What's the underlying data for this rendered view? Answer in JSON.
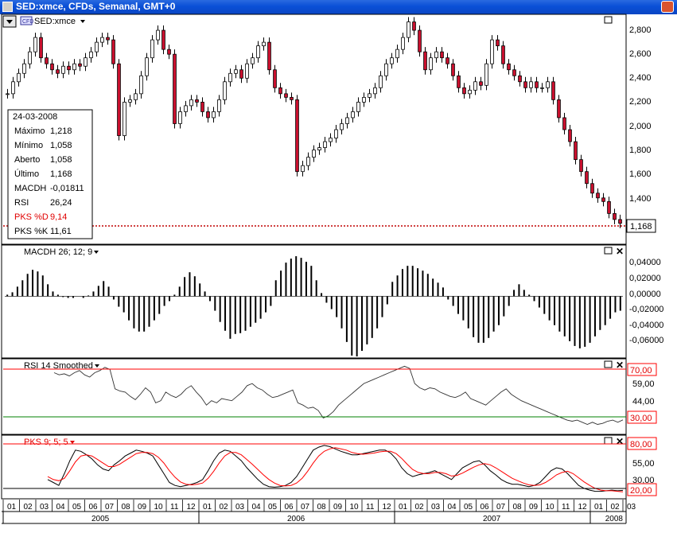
{
  "window": {
    "title": "SED:xmce, CFDs, Semanal, GMT+0"
  },
  "symbol_label": "SED:xmce",
  "price_panel": {
    "y_ticks": [
      "2,800",
      "2,600",
      "2,400",
      "2,200",
      "2,000",
      "1,800",
      "1,600",
      "1,400"
    ],
    "last_price_label": "1,168"
  },
  "info_box": {
    "date": "24-03-2008",
    "rows": [
      {
        "label": "Máximo",
        "value": "1,218"
      },
      {
        "label": "Mínimo",
        "value": "1,058"
      },
      {
        "label": "Aberto",
        "value": "1,058"
      },
      {
        "label": "Último",
        "value": "1,168"
      },
      {
        "label": "MACDH",
        "value": "-0,01811"
      },
      {
        "label": "RSI",
        "value": "26,24"
      },
      {
        "label": "PKS %D",
        "value": "9,14"
      },
      {
        "label": "PKS %K",
        "value": "11,61"
      }
    ]
  },
  "macd_panel": {
    "title": "MACDH 26; 12; 9",
    "y_ticks": [
      "0,04000",
      "0,02000",
      "0,00000",
      "-0,02000",
      "-0,04000",
      "-0,06000"
    ]
  },
  "rsi_panel": {
    "title": "RSI 14 Smoothed",
    "y_ticks": [
      "59,00",
      "44,00"
    ],
    "levels": [
      "70,00",
      "30,00"
    ]
  },
  "pks_panel": {
    "title": "PKS 9; 5; 5",
    "y_ticks": [
      "55,00",
      "30,00"
    ],
    "levels": [
      "80,00",
      "20,00"
    ]
  },
  "x_axis": {
    "months": [
      "01",
      "02",
      "03",
      "04",
      "05",
      "06",
      "07",
      "08",
      "09",
      "10",
      "11",
      "12",
      "01",
      "02",
      "03",
      "04",
      "05",
      "06",
      "07",
      "08",
      "09",
      "10",
      "11",
      "12",
      "01",
      "02",
      "03",
      "04",
      "05",
      "06",
      "07",
      "08",
      "09",
      "10",
      "11",
      "12",
      "01",
      "02",
      "03"
    ],
    "years": [
      "2005",
      "2006",
      "2007",
      "2008"
    ]
  },
  "colors": {
    "up_candle": "#ffffff",
    "down_candle": "#c8102e",
    "pks_d": "#ff0000",
    "pks_k": "#000000",
    "level_red": "#ff0000",
    "level_green": "#008000",
    "last_price_line": "#c00000"
  },
  "chart_data": [
    {
      "type": "candlestick",
      "title": "SED:xmce, CFDs, Semanal, GMT+0",
      "x_unit": "week",
      "ylim": [
        1.0,
        2.9
      ],
      "series": [
        {
          "values": [
            2.25,
            2.35,
            2.42,
            2.5,
            2.6,
            2.72,
            2.55,
            2.5,
            2.45,
            2.42,
            2.48,
            2.45,
            2.5,
            2.48,
            2.55,
            2.6,
            2.68,
            2.72,
            2.7,
            2.5,
            1.9,
            2.18,
            2.2,
            2.25,
            2.4,
            2.55,
            2.7,
            2.78,
            2.62,
            2.58,
            2.0,
            2.1,
            2.15,
            2.2,
            2.18,
            2.1,
            2.05,
            2.1,
            2.2,
            2.35,
            2.42,
            2.45,
            2.38,
            2.5,
            2.55,
            2.65,
            2.68,
            2.45,
            2.3,
            2.25,
            2.22,
            2.2,
            1.6,
            1.65,
            1.72,
            1.78,
            1.8,
            1.85,
            1.88,
            1.95,
            2.0,
            2.05,
            2.1,
            2.18,
            2.22,
            2.25,
            2.3,
            2.4,
            2.5,
            2.55,
            2.62,
            2.72,
            2.85,
            2.78,
            2.6,
            2.45,
            2.55,
            2.6,
            2.55,
            2.5,
            2.4,
            2.3,
            2.25,
            2.28,
            2.35,
            2.32,
            2.5,
            2.7,
            2.65,
            2.5,
            2.45,
            2.4,
            2.35,
            2.3,
            2.35,
            2.3,
            2.3,
            2.35,
            2.2,
            2.05,
            1.95,
            1.85,
            1.7,
            1.6,
            1.5,
            1.42,
            1.38,
            1.35,
            1.25,
            1.2,
            1.168
          ]
        }
      ]
    },
    {
      "type": "bar",
      "title": "MACDH 26; 12; 9",
      "ylim": [
        -0.075,
        0.06
      ],
      "series": [
        {
          "values": [
            0.002,
            0.005,
            0.012,
            0.02,
            0.028,
            0.033,
            0.031,
            0.026,
            0.015,
            0.006,
            0.002,
            -0.001,
            -0.002,
            -0.002,
            0.0,
            -0.002,
            0.001,
            0.006,
            0.013,
            0.019,
            0.012,
            -0.004,
            -0.013,
            -0.02,
            -0.03,
            -0.04,
            -0.044,
            -0.044,
            -0.038,
            -0.03,
            -0.022,
            -0.012,
            -0.006,
            0.002,
            0.012,
            0.024,
            0.03,
            0.025,
            0.016,
            0.006,
            -0.006,
            -0.018,
            -0.032,
            -0.043,
            -0.053,
            -0.047,
            -0.046,
            -0.043,
            -0.038,
            -0.033,
            -0.028,
            -0.02,
            -0.012,
            0.02,
            0.032,
            0.042,
            0.047,
            0.05,
            0.048,
            0.043,
            0.038,
            0.02,
            0.004,
            -0.008,
            -0.016,
            -0.026,
            -0.04,
            -0.057,
            -0.074,
            -0.075,
            -0.068,
            -0.06,
            -0.052,
            -0.04,
            -0.026,
            -0.01,
            0.018,
            0.026,
            0.034,
            0.038,
            0.038,
            0.035,
            0.032,
            0.028,
            0.022,
            0.017,
            0.011,
            -0.004,
            -0.012,
            -0.022,
            -0.03,
            -0.04,
            -0.051,
            -0.058,
            -0.058,
            -0.052,
            -0.044,
            -0.036,
            -0.025,
            -0.012,
            0.008,
            0.015,
            0.008,
            0.002,
            -0.006,
            -0.014,
            -0.022,
            -0.03,
            -0.036,
            -0.044,
            -0.05,
            -0.056,
            -0.062,
            -0.065,
            -0.063,
            -0.058,
            -0.05,
            -0.042,
            -0.036,
            -0.028,
            -0.02,
            -0.018
          ]
        }
      ]
    },
    {
      "type": "line",
      "title": "RSI 14 Smoothed",
      "ylim": [
        15,
        80
      ],
      "series": [
        {
          "values": [
            70,
            68,
            69,
            67,
            70,
            72,
            68,
            66,
            70,
            72,
            75,
            73,
            55,
            53,
            52,
            48,
            45,
            50,
            56,
            52,
            42,
            44,
            52,
            49,
            47,
            50,
            55,
            58,
            52,
            47,
            40,
            44,
            42,
            46,
            45,
            44,
            48,
            52,
            58,
            60,
            56,
            54,
            50,
            47,
            48,
            50,
            52,
            54,
            42,
            40,
            37,
            38,
            35,
            28,
            30,
            34,
            40,
            44,
            48,
            52,
            56,
            60,
            62,
            64,
            66,
            68,
            70,
            72,
            74,
            76,
            74,
            60,
            56,
            54,
            56,
            55,
            52,
            50,
            48,
            47,
            49,
            52,
            46,
            44,
            42,
            40,
            44,
            48,
            52,
            55,
            50,
            47,
            44,
            42,
            40,
            38,
            36,
            34,
            32,
            30,
            28,
            26,
            25,
            26,
            24,
            22,
            24,
            22,
            23,
            25,
            26,
            24,
            26.24
          ]
        }
      ]
    },
    {
      "type": "line",
      "title": "PKS 9; 5; 5",
      "ylim": [
        0,
        100
      ],
      "series": [
        {
          "name": "PKS %K",
          "values": [
            30,
            25,
            20,
            40,
            62,
            80,
            78,
            72,
            65,
            55,
            48,
            45,
            55,
            62,
            70,
            75,
            80,
            78,
            75,
            70,
            55,
            40,
            25,
            20,
            18,
            20,
            22,
            25,
            30,
            45,
            62,
            75,
            80,
            78,
            70,
            62,
            50,
            40,
            30,
            22,
            18,
            17,
            18,
            20,
            25,
            35,
            50,
            65,
            80,
            85,
            88,
            86,
            82,
            78,
            75,
            72,
            72,
            74,
            76,
            78,
            80,
            80,
            75,
            65,
            50,
            40,
            35,
            38,
            40,
            42,
            45,
            40,
            35,
            30,
            40,
            50,
            55,
            60,
            62,
            55,
            45,
            38,
            30,
            25,
            22,
            22,
            20,
            18,
            20,
            25,
            35,
            45,
            50,
            48,
            40,
            30,
            20,
            15,
            12,
            10,
            10,
            11,
            12,
            11,
            11.61
          ]
        },
        {
          "name": "PKS %D",
          "values": [
            35,
            30,
            28,
            32,
            45,
            60,
            70,
            72,
            70,
            64,
            58,
            52,
            52,
            56,
            62,
            68,
            74,
            76,
            76,
            74,
            68,
            58,
            45,
            34,
            26,
            22,
            21,
            22,
            24,
            32,
            44,
            58,
            70,
            76,
            76,
            72,
            64,
            56,
            47,
            38,
            30,
            24,
            20,
            19,
            20,
            24,
            32,
            44,
            58,
            70,
            78,
            82,
            84,
            82,
            80,
            76,
            74,
            73,
            74,
            75,
            77,
            78,
            78,
            74,
            66,
            56,
            47,
            42,
            40,
            40,
            42,
            42,
            40,
            36,
            37,
            41,
            46,
            51,
            55,
            57,
            55,
            50,
            44,
            38,
            32,
            28,
            24,
            21,
            20,
            21,
            25,
            31,
            38,
            42,
            44,
            40,
            33,
            26,
            20,
            15,
            12,
            11,
            11,
            10,
            9.14
          ]
        }
      ]
    }
  ]
}
